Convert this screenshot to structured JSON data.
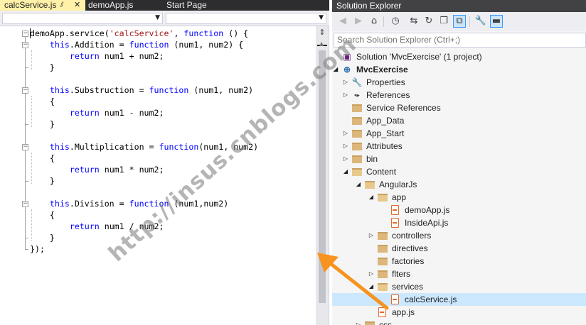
{
  "editor": {
    "tabs": [
      {
        "label": "calcService.js",
        "active": true
      },
      {
        "label": "demoApp.js",
        "active": false
      },
      {
        "label": "Start Page",
        "active": false
      }
    ],
    "pin_glyph": "⫽",
    "close_glyph": "✕",
    "code_lines": [
      [
        {
          "t": "demoApp.service("
        },
        {
          "t": "'calcService'",
          "c": "str"
        },
        {
          "t": ", "
        },
        {
          "t": "function",
          "c": "kw"
        },
        {
          "t": " () {"
        }
      ],
      [
        {
          "t": "    "
        },
        {
          "t": "this",
          "c": "kw"
        },
        {
          "t": ".Addition = "
        },
        {
          "t": "function",
          "c": "kw"
        },
        {
          "t": " (num1, num2) {"
        }
      ],
      [
        {
          "t": "        "
        },
        {
          "t": "return",
          "c": "kw"
        },
        {
          "t": " num1 + num2;"
        }
      ],
      [
        {
          "t": "    }"
        }
      ],
      [
        {
          "t": ""
        }
      ],
      [
        {
          "t": "    "
        },
        {
          "t": "this",
          "c": "kw"
        },
        {
          "t": ".Substruction = "
        },
        {
          "t": "function",
          "c": "kw"
        },
        {
          "t": " (num1, num2)"
        }
      ],
      [
        {
          "t": "    {"
        }
      ],
      [
        {
          "t": "        "
        },
        {
          "t": "return",
          "c": "kw"
        },
        {
          "t": " num1 - num2;"
        }
      ],
      [
        {
          "t": "    }"
        }
      ],
      [
        {
          "t": ""
        }
      ],
      [
        {
          "t": "    "
        },
        {
          "t": "this",
          "c": "kw"
        },
        {
          "t": ".Multiplication = "
        },
        {
          "t": "function",
          "c": "kw"
        },
        {
          "t": "(num1, num2)"
        }
      ],
      [
        {
          "t": "    {"
        }
      ],
      [
        {
          "t": "        "
        },
        {
          "t": "return",
          "c": "kw"
        },
        {
          "t": " num1 * num2;"
        }
      ],
      [
        {
          "t": "    }"
        }
      ],
      [
        {
          "t": ""
        }
      ],
      [
        {
          "t": "    "
        },
        {
          "t": "this",
          "c": "kw"
        },
        {
          "t": ".Division = "
        },
        {
          "t": "function",
          "c": "kw"
        },
        {
          "t": " (num1,num2)"
        }
      ],
      [
        {
          "t": "    {"
        }
      ],
      [
        {
          "t": "        "
        },
        {
          "t": "return",
          "c": "kw"
        },
        {
          "t": " num1 / num2;"
        }
      ],
      [
        {
          "t": "    }"
        }
      ],
      [
        {
          "t": "});"
        }
      ]
    ]
  },
  "solution_explorer": {
    "title": "Solution Explorer",
    "search_placeholder": "Search Solution Explorer (Ctrl+;)",
    "toolbar_icons": [
      "back-icon",
      "forward-icon",
      "home-icon",
      "history-icon",
      "sync-icon",
      "refresh-icon",
      "collapse-all-icon",
      "show-all-files-icon",
      "properties-icon",
      "preview-icon"
    ],
    "tree": [
      {
        "label": "Solution 'MvcExercise' (1 project)",
        "depth": 0,
        "icon": "solution",
        "expander": ""
      },
      {
        "label": "MvcExercise",
        "depth": 0,
        "icon": "web-project",
        "expander": "open",
        "bold": true
      },
      {
        "label": "Properties",
        "depth": 1,
        "icon": "wrench",
        "expander": "closed"
      },
      {
        "label": "References",
        "depth": 1,
        "icon": "references",
        "expander": "closed"
      },
      {
        "label": "Service References",
        "depth": 1,
        "icon": "folder",
        "expander": ""
      },
      {
        "label": "App_Data",
        "depth": 1,
        "icon": "folder",
        "expander": ""
      },
      {
        "label": "App_Start",
        "depth": 1,
        "icon": "folder",
        "expander": "closed"
      },
      {
        "label": "Attributes",
        "depth": 1,
        "icon": "folder",
        "expander": "closed"
      },
      {
        "label": "bin",
        "depth": 1,
        "icon": "folder",
        "expander": "closed"
      },
      {
        "label": "Content",
        "depth": 1,
        "icon": "folder-open",
        "expander": "open"
      },
      {
        "label": "AngularJs",
        "depth": 2,
        "icon": "folder-open",
        "expander": "open"
      },
      {
        "label": "app",
        "depth": 3,
        "icon": "folder-open",
        "expander": "open"
      },
      {
        "label": "demoApp.js",
        "depth": 4,
        "icon": "js-file",
        "expander": ""
      },
      {
        "label": "InsideApi.js",
        "depth": 4,
        "icon": "js-file",
        "expander": ""
      },
      {
        "label": "controllers",
        "depth": 3,
        "icon": "folder",
        "expander": "closed"
      },
      {
        "label": "directives",
        "depth": 3,
        "icon": "folder",
        "expander": ""
      },
      {
        "label": "factories",
        "depth": 3,
        "icon": "folder",
        "expander": ""
      },
      {
        "label": "flters",
        "depth": 3,
        "icon": "folder",
        "expander": "closed"
      },
      {
        "label": "services",
        "depth": 3,
        "icon": "folder-open",
        "expander": "open"
      },
      {
        "label": "calcService.js",
        "depth": 4,
        "icon": "js-file",
        "expander": "",
        "selected": true
      },
      {
        "label": "app.js",
        "depth": 3,
        "icon": "js-file",
        "expander": ""
      },
      {
        "label": "css",
        "depth": 2,
        "icon": "folder",
        "expander": "closed"
      }
    ]
  },
  "watermark": "http://insus.cnblogs.com",
  "colors": {
    "keyword": "#0000ff",
    "string": "#a31515",
    "active_tab": "#fff1a8",
    "selection": "#cce8ff",
    "arrow": "#f7931e"
  }
}
